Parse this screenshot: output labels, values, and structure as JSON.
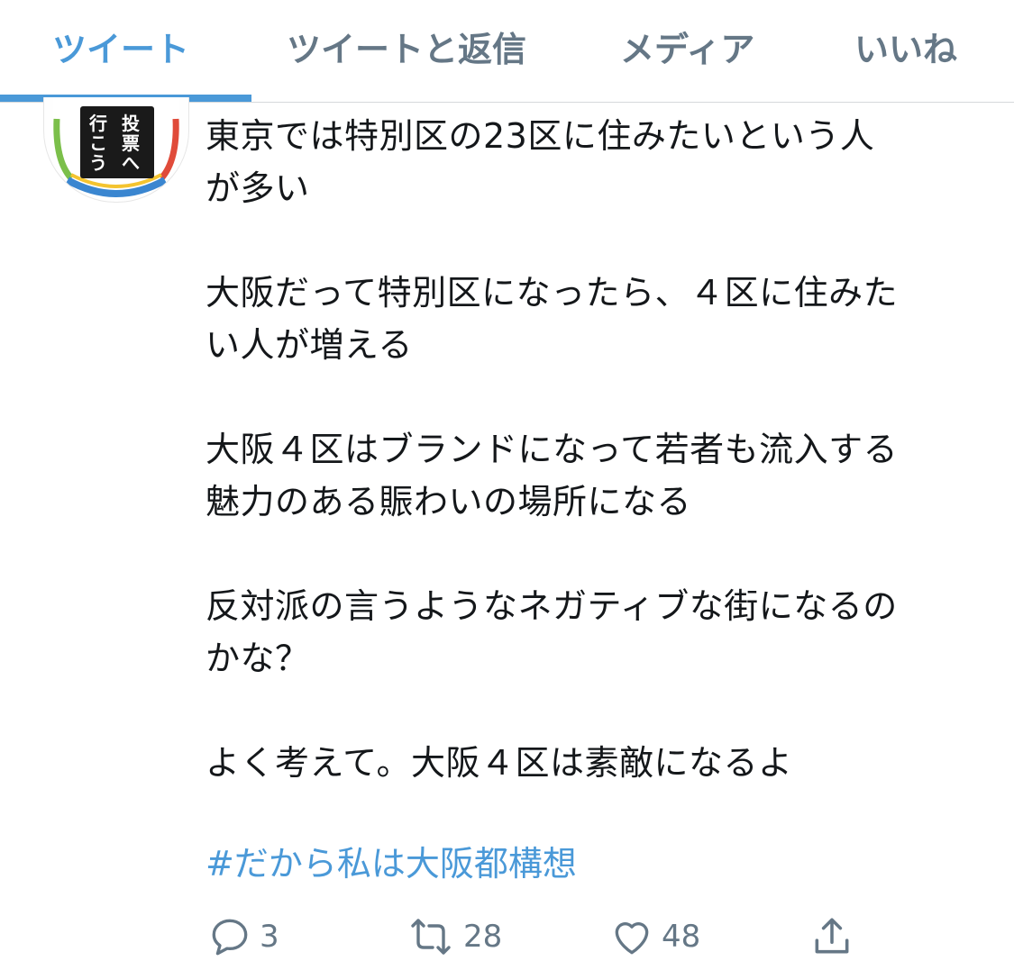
{
  "tabs": [
    {
      "label": "ツイート",
      "active": true
    },
    {
      "label": "ツイートと返信",
      "active": false
    },
    {
      "label": "メディア",
      "active": false
    },
    {
      "label": "いいね",
      "active": false
    }
  ],
  "tweet": {
    "avatar_text": "投票へ行こう",
    "paragraphs": [
      "東京では特別区の23区に住みたいという人\nが多い",
      "大阪だって特別区になったら、４区に住みた\nい人が増える",
      "大阪４区はブランドになって若者も流入する\n魅力のある賑わいの場所になる",
      "反対派の言うようなネガティブな街になるの\nかな？",
      "よく考えて。大阪４区は素敵になるよ"
    ],
    "hashtag": "#だから私は大阪都構想",
    "actions": {
      "reply": {
        "icon": "reply-icon",
        "count": "3"
      },
      "retweet": {
        "icon": "retweet-icon",
        "count": "28"
      },
      "like": {
        "icon": "heart-icon",
        "count": "48"
      },
      "share": {
        "icon": "share-icon"
      }
    }
  },
  "colors": {
    "accent": "#4a99d8",
    "text": "#14171a",
    "muted": "#657786"
  }
}
